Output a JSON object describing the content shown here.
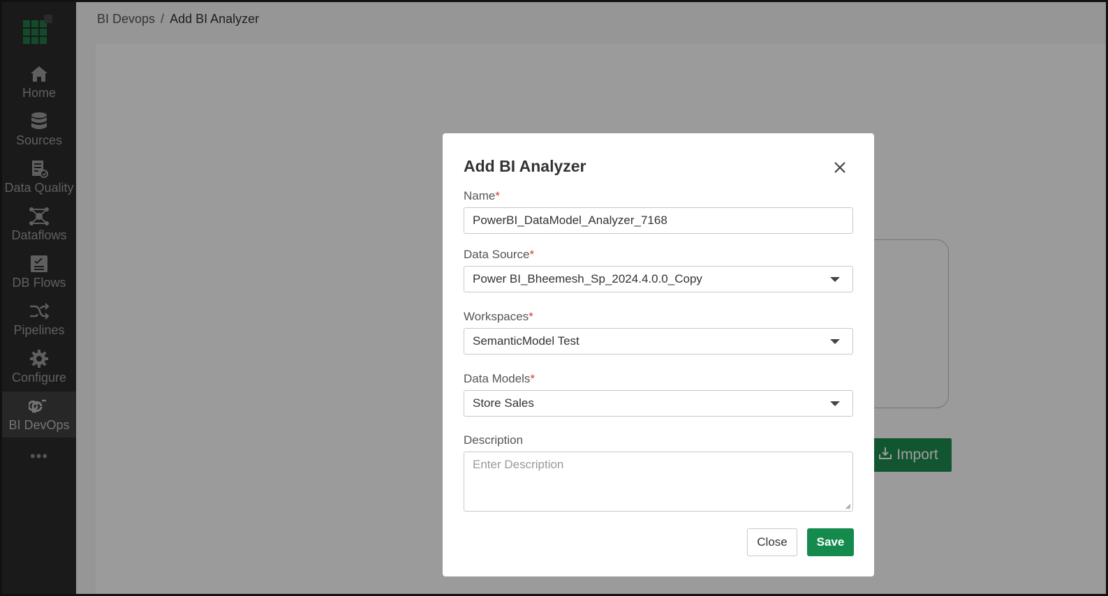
{
  "sidebar": {
    "items": [
      {
        "label": "Home",
        "icon": "home-icon"
      },
      {
        "label": "Sources",
        "icon": "database-icon"
      },
      {
        "label": "Data Quality",
        "icon": "data-quality-icon"
      },
      {
        "label": "Dataflows",
        "icon": "dataflows-icon"
      },
      {
        "label": "DB Flows",
        "icon": "db-flows-icon"
      },
      {
        "label": "Pipelines",
        "icon": "shuffle-icon"
      },
      {
        "label": "Configure",
        "icon": "gear-icon"
      },
      {
        "label": "BI DevOps",
        "icon": "bi-devops-icon",
        "active": true
      }
    ],
    "more": "•••"
  },
  "breadcrumb": {
    "parent": "BI Devops",
    "separator": "/",
    "current": "Add BI Analyzer"
  },
  "background": {
    "import_label": "Import"
  },
  "modal": {
    "title": "Add BI Analyzer",
    "required_mark": "*",
    "name": {
      "label": "Name",
      "value": "PowerBI_DataModel_Analyzer_7168"
    },
    "data_source": {
      "label": "Data Source",
      "value": "Power BI_Bheemesh_Sp_2024.4.0.0_Copy"
    },
    "workspaces": {
      "label": "Workspaces",
      "value": "SemanticModel Test"
    },
    "data_models": {
      "label": "Data Models",
      "value": "Store Sales"
    },
    "description": {
      "label": "Description",
      "placeholder": "Enter Description"
    },
    "close_label": "Close",
    "save_label": "Save"
  },
  "colors": {
    "sidebar_bg": "#2b2b2b",
    "accent": "#148a4c",
    "required": "#d23a3a"
  }
}
